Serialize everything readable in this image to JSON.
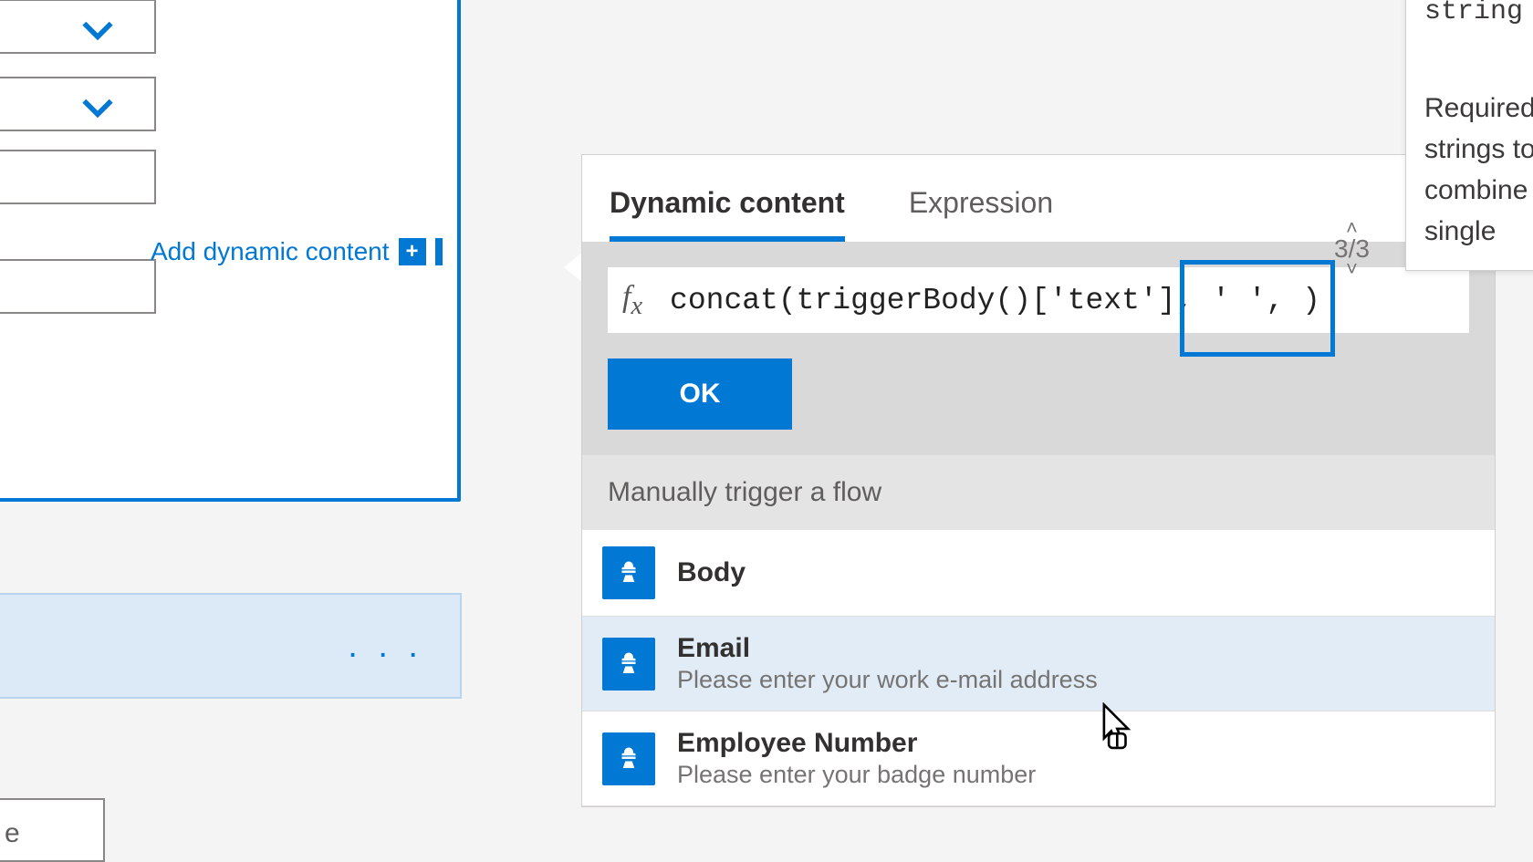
{
  "left": {
    "add_dynamic": "Add dynamic content"
  },
  "popout": {
    "tabs": {
      "dynamic": "Dynamic content",
      "expression": "Expression"
    },
    "formula": "concat(triggerBody()['text'], ' ', )",
    "ok": "OK",
    "section": "Manually trigger a flow",
    "items": [
      {
        "title": "Body",
        "desc": ""
      },
      {
        "title": "Email",
        "desc": "Please enter your work e-mail address"
      },
      {
        "title": "Employee Number",
        "desc": "Please enter your badge number"
      }
    ],
    "pager": "3/3"
  },
  "tip": {
    "line1": "string",
    "line2": "Required. The strings to combine into a single"
  },
  "tiny": "e"
}
